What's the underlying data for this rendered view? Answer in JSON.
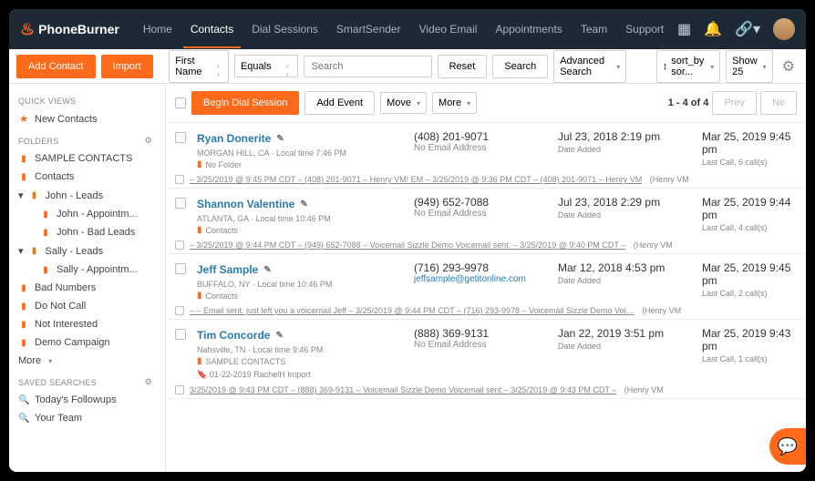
{
  "brand": "PhoneBurner",
  "nav": [
    "Home",
    "Contacts",
    "Dial Sessions",
    "SmartSender",
    "Video Email",
    "Appointments",
    "Team",
    "Support"
  ],
  "activeNav": 1,
  "toolbar": {
    "addContact": "Add Contact",
    "import": "Import",
    "filterField": "First Name",
    "filterOp": "Equals",
    "searchPlaceholder": "Search",
    "reset": "Reset",
    "search": "Search",
    "advanced": "Advanced Search",
    "sort": "sort_by sor...",
    "show": "Show 25"
  },
  "sidebar": {
    "quickViews": "QUICK VIEWS",
    "newContacts": "New Contacts",
    "folders": "FOLDERS",
    "items": [
      {
        "label": "SAMPLE CONTACTS",
        "cls": "fld",
        "indent": 0
      },
      {
        "label": "Contacts",
        "cls": "fld",
        "indent": 0
      },
      {
        "label": "John - Leads",
        "cls": "fldc",
        "indent": 0,
        "open": true
      },
      {
        "label": "John - Appointm...",
        "cls": "fld",
        "indent": 2
      },
      {
        "label": "John - Bad Leads",
        "cls": "fld",
        "indent": 2
      },
      {
        "label": "Sally - Leads",
        "cls": "fldc",
        "indent": 0,
        "open": true
      },
      {
        "label": "Sally - Appointm...",
        "cls": "fld",
        "indent": 2
      },
      {
        "label": "Bad Numbers",
        "cls": "fld",
        "indent": 0
      },
      {
        "label": "Do Not Call",
        "cls": "fld",
        "indent": 0
      },
      {
        "label": "Not Interested",
        "cls": "fld",
        "indent": 0
      },
      {
        "label": "Demo Campaign",
        "cls": "fld",
        "indent": 0
      }
    ],
    "more": "More",
    "savedSearches": "SAVED SEARCHES",
    "saved": [
      "Today's Followups",
      "Your Team"
    ]
  },
  "actionbar": {
    "begin": "Begin Dial Session",
    "addEvent": "Add Event",
    "move": "Move",
    "more": "More",
    "pagination": "1 - 4 of 4",
    "prev": "Prev",
    "next": "Ne"
  },
  "contacts": [
    {
      "name": "Ryan Donerite",
      "loc": "MORGAN HILL, CA · Local time 7:46 PM",
      "folder": "No Folder",
      "phone": "(408) 201-9071",
      "email": "No Email Address",
      "emailLink": false,
      "date": "Jul 23, 2018 2:19 pm",
      "dateSub": "Date Added",
      "last": "Mar 25, 2019 9:45 pm",
      "lastSub": "Last Call, 6 call(s)",
      "footer": "– 3/25/2019 @ 9:45 PM CDT – (408) 201-9071 – Henry VM! EM – 3/25/2019 @ 9:36 PM CDT – (408) 201-9071 – Henry VM",
      "footer2": "(Henry VM"
    },
    {
      "name": "Shannon Valentine",
      "loc": "ATLANTA, GA · Local time 10:46 PM",
      "folder": "Contacts",
      "phone": "(949) 652-7088",
      "email": "No Email Address",
      "emailLink": false,
      "date": "Jul 23, 2018 2:29 pm",
      "dateSub": "Date Added",
      "last": "Mar 25, 2019 9:44 pm",
      "lastSub": "Last Call, 4 call(s)",
      "footer": "– 3/25/2019 @ 9:44 PM CDT – (949) 652-7088 – Voicemail Sizzle Demo Voicemail sent. – 3/25/2019 @ 9:40 PM CDT –",
      "footer2": "(Henry VM"
    },
    {
      "name": "Jeff Sample",
      "loc": "BUFFALO, NY · Local time 10:46 PM",
      "folder": "Contacts",
      "phone": "(716) 293-9978",
      "email": "jeffsample@getitonline.com",
      "emailLink": true,
      "date": "Mar 12, 2018 4:53 pm",
      "dateSub": "Date Added",
      "last": "Mar 25, 2019 9:45 pm",
      "lastSub": "Last Call, 2 call(s)",
      "footer": "– – Email sent, just left you a voicemail Jeff – 3/25/2019 @ 9:44 PM CDT – (716) 293-9978 – Voicemail Sizzle Demo Voi…",
      "footer2": "(Henry VM"
    },
    {
      "name": "Tim Concorde",
      "loc": "Nahsville, TN · Local time 9:46 PM",
      "folder": "SAMPLE CONTACTS",
      "phone": "(888) 369-9131",
      "email": "No Email Address",
      "emailLink": false,
      "date": "Jan 22, 2019 3:51 pm",
      "dateSub": "Date Added",
      "last": "Mar 25, 2019 9:43 pm",
      "lastSub": "Last Call, 1 call(s)",
      "tag": "01-22-2019 RachelH Import",
      "footer": "3/25/2019 @ 9:43 PM CDT – (888) 369-9131 – Voicemail Sizzle Demo Voicemail sent – 3/25/2019 @ 9:43 PM CDT –",
      "footer2": "(Henry VM"
    }
  ]
}
